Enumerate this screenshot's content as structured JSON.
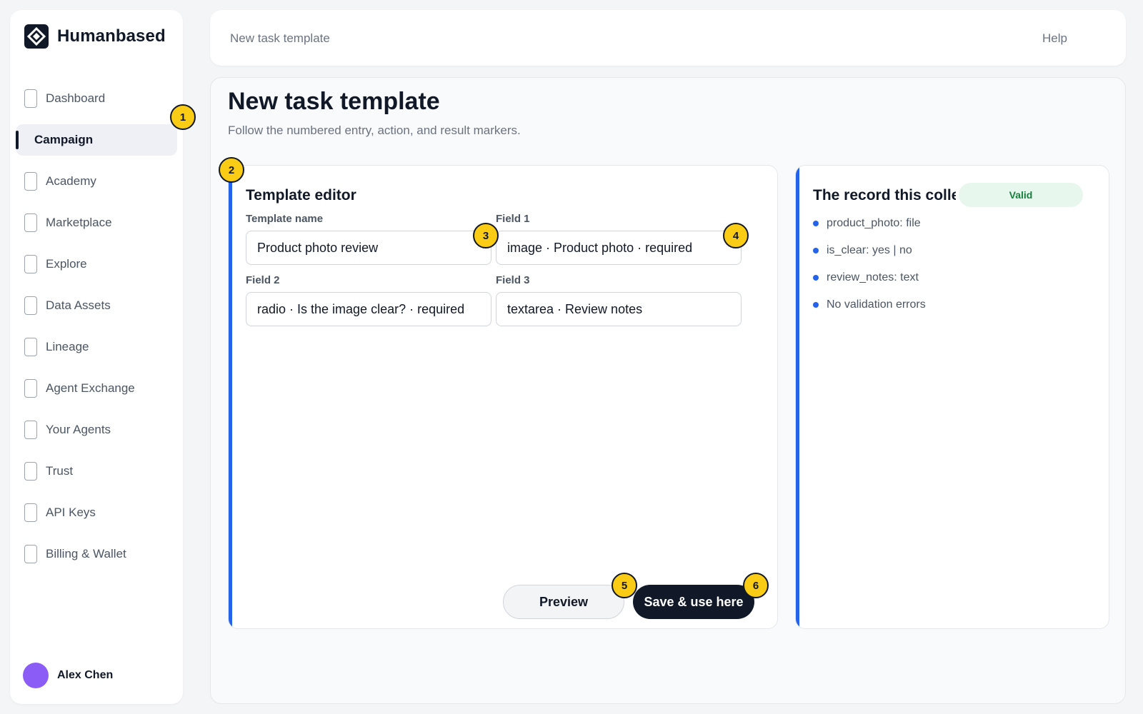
{
  "brand": {
    "name": "Humanbased",
    "logo_icon": "diamond-logo-icon"
  },
  "sidebar": {
    "items": [
      {
        "label": "Dashboard",
        "active": false
      },
      {
        "label": "Campaign",
        "active": true
      },
      {
        "label": "Academy",
        "active": false
      },
      {
        "label": "Marketplace",
        "active": false
      },
      {
        "label": "Explore",
        "active": false
      },
      {
        "label": "Data Assets",
        "active": false
      },
      {
        "label": "Lineage",
        "active": false
      },
      {
        "label": "Agent Exchange",
        "active": false
      },
      {
        "label": "Your Agents",
        "active": false
      },
      {
        "label": "Trust",
        "active": false
      },
      {
        "label": "API Keys",
        "active": false
      },
      {
        "label": "Billing & Wallet",
        "active": false
      }
    ],
    "user": {
      "name": "Alex Chen",
      "avatar_color": "#8b5cf6"
    }
  },
  "topbar": {
    "title": "New task template",
    "help_label": "Help"
  },
  "page": {
    "title": "New task template",
    "subtitle": "Follow the numbered entry, action, and result markers."
  },
  "editor": {
    "title": "Template editor",
    "fields": [
      {
        "label": "Template name",
        "value": "Product photo review"
      },
      {
        "label": "Field 1",
        "value": "image · Product photo · required"
      },
      {
        "label": "Field 2",
        "value": "radio · Is the image clear? · required"
      },
      {
        "label": "Field 3",
        "value": "textarea · Review notes"
      }
    ],
    "preview_label": "Preview",
    "save_label": "Save & use here"
  },
  "record": {
    "title": "The record this collects",
    "badge": "Valid",
    "items": [
      "product_photo: file",
      "is_clear: yes | no",
      "review_notes: text",
      "No validation errors"
    ]
  },
  "markers": [
    "1",
    "2",
    "3",
    "4",
    "5",
    "6"
  ],
  "colors": {
    "accent": "#2563eb",
    "marker": "#facc15",
    "dark": "#111827",
    "valid_bg": "#e8f7ee",
    "valid_text": "#15803d"
  }
}
